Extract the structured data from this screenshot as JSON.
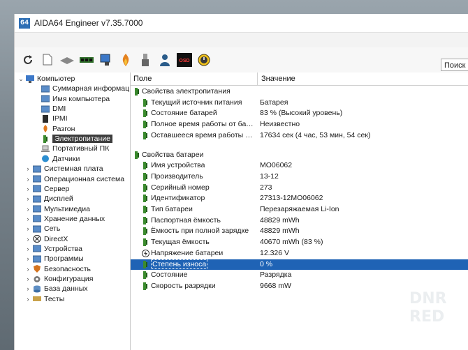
{
  "app": {
    "title": "AIDA64 Engineer v7.35.7000",
    "icon_text": "64"
  },
  "toolbar": {
    "buttons": [
      "refresh-icon",
      "report-icon",
      "chip-icon",
      "memory-icon",
      "monitor-icon",
      "flame-icon",
      "usb-icon",
      "user-icon",
      "osd-icon",
      "clock-icon"
    ],
    "osd_label": "OSD",
    "search_label": "Поиск"
  },
  "tree": {
    "items": [
      {
        "label": "Компьютер",
        "arrow": "⌄",
        "icon": "computer-icon"
      },
      {
        "label": "Суммарная информац",
        "arrow": "",
        "icon": "summary-icon"
      },
      {
        "label": "Имя компьютера",
        "arrow": "",
        "icon": "computer-name-icon"
      },
      {
        "label": "DMI",
        "arrow": "",
        "icon": "dmi-icon"
      },
      {
        "label": "IPMI",
        "arrow": "",
        "icon": "ipmi-icon"
      },
      {
        "label": "Разгон",
        "arrow": "",
        "icon": "overclock-icon"
      },
      {
        "label": "Электропитание",
        "arrow": "",
        "icon": "power-icon",
        "selected": true
      },
      {
        "label": "Портативный ПК",
        "arrow": "",
        "icon": "laptop-icon"
      },
      {
        "label": "Датчики",
        "arrow": "",
        "icon": "sensor-icon"
      },
      {
        "label": "Системная плата",
        "arrow": "›",
        "icon": "motherboard-icon"
      },
      {
        "label": "Операционная система",
        "arrow": "›",
        "icon": "os-icon"
      },
      {
        "label": "Сервер",
        "arrow": "›",
        "icon": "server-icon"
      },
      {
        "label": "Дисплей",
        "arrow": "›",
        "icon": "display-icon"
      },
      {
        "label": "Мультимедиа",
        "arrow": "›",
        "icon": "multimedia-icon"
      },
      {
        "label": "Хранение данных",
        "arrow": "›",
        "icon": "storage-icon"
      },
      {
        "label": "Сеть",
        "arrow": "›",
        "icon": "network-icon"
      },
      {
        "label": "DirectX",
        "arrow": "›",
        "icon": "directx-icon"
      },
      {
        "label": "Устройства",
        "arrow": "›",
        "icon": "devices-icon"
      },
      {
        "label": "Программы",
        "arrow": "›",
        "icon": "programs-icon"
      },
      {
        "label": "Безопасность",
        "arrow": "›",
        "icon": "security-icon"
      },
      {
        "label": "Конфигурация",
        "arrow": "›",
        "icon": "config-icon"
      },
      {
        "label": "База данных",
        "arrow": "›",
        "icon": "database-icon"
      },
      {
        "label": "Тесты",
        "arrow": "›",
        "icon": "tests-icon"
      }
    ]
  },
  "table": {
    "col_field": "Поле",
    "col_value": "Значение",
    "rows": [
      {
        "type": "group",
        "name": "Свойства электропитания",
        "icon": "power-icon"
      },
      {
        "type": "item",
        "name": "Текущий источник питания",
        "value": "Батарея",
        "icon": "power-icon"
      },
      {
        "type": "item",
        "name": "Состояние батарей",
        "value": "83 % (Высокий уровень)",
        "icon": "power-icon"
      },
      {
        "type": "item",
        "name": "Полное время работы от бата...",
        "value": "Неизвестно",
        "icon": "power-icon"
      },
      {
        "type": "item",
        "name": "Оставшееся время работы от ...",
        "value": "17634 сек (4 час, 53 мин, 54 сек)",
        "icon": "power-icon"
      },
      {
        "type": "blank"
      },
      {
        "type": "group",
        "name": "Свойства батареи",
        "icon": "power-icon"
      },
      {
        "type": "item",
        "name": "Имя устройства",
        "value": "MO06062",
        "icon": "power-icon"
      },
      {
        "type": "item",
        "name": "Производитель",
        "value": "13-12",
        "icon": "power-icon"
      },
      {
        "type": "item",
        "name": "Серийный номер",
        "value": "273",
        "icon": "power-icon"
      },
      {
        "type": "item",
        "name": "Идентификатор",
        "value": "27313-12MO06062",
        "icon": "power-icon"
      },
      {
        "type": "item",
        "name": "Тип батареи",
        "value": "Перезаряжаемая Li-Ion",
        "icon": "power-icon"
      },
      {
        "type": "item",
        "name": "Паспортная ёмкость",
        "value": "48829 mWh",
        "icon": "power-icon"
      },
      {
        "type": "item",
        "name": "Ёмкость при полной зарядке",
        "value": "48829 mWh",
        "icon": "power-icon"
      },
      {
        "type": "item",
        "name": "Текущая ёмкость",
        "value": "40670 mWh  (83 %)",
        "icon": "power-icon"
      },
      {
        "type": "item",
        "name": "Напряжение батареи",
        "value": "12.326 V",
        "icon": "voltage-icon"
      },
      {
        "type": "item",
        "name": "Степень износа",
        "value": "0 %",
        "icon": "power-icon",
        "selected": true
      },
      {
        "type": "item",
        "name": "Состояние",
        "value": "Разрядка",
        "icon": "power-icon"
      },
      {
        "type": "item",
        "name": "Скорость разрядки",
        "value": "9668 mW",
        "icon": "power-icon"
      }
    ]
  },
  "watermark": {
    "line1": "DNR",
    "line2": "RED"
  },
  "colors": {
    "selection": "#1f63b5",
    "tree_selection": "#3d3d3d",
    "icon_green": "#3b8a2e",
    "icon_yellow": "#e8c21a"
  }
}
